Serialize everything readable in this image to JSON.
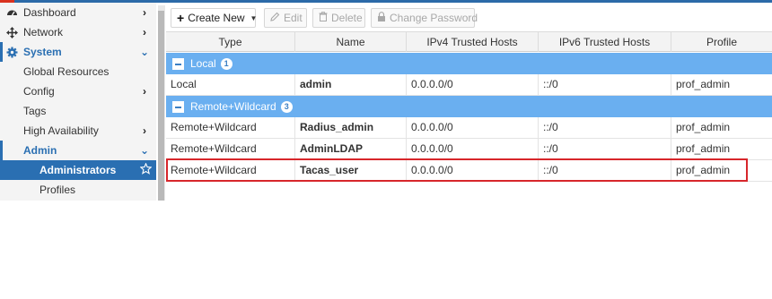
{
  "sidebar": {
    "items": [
      {
        "label": "Dashboard",
        "icon": "dashboard-icon",
        "chevron": "›"
      },
      {
        "label": "Network",
        "icon": "network-icon",
        "chevron": "›"
      },
      {
        "label": "System",
        "icon": "gear-icon",
        "chevron": "⌄"
      },
      {
        "label": "Global Resources"
      },
      {
        "label": "Config",
        "chevron": "›"
      },
      {
        "label": "Tags"
      },
      {
        "label": "High Availability",
        "chevron": "›"
      },
      {
        "label": "Admin",
        "chevron": "⌄"
      },
      {
        "label": "Administrators",
        "icon": "star-icon"
      },
      {
        "label": "Profiles"
      }
    ]
  },
  "toolbar": {
    "create_new": "Create New",
    "edit": "Edit",
    "delete": "Delete",
    "change_password": "Change Password"
  },
  "table": {
    "columns": [
      "Type",
      "Name",
      "IPv4 Trusted Hosts",
      "IPv6 Trusted Hosts",
      "Profile"
    ],
    "groups": [
      {
        "label": "Local",
        "count": "1",
        "rows": [
          {
            "type": "Local",
            "name": "admin",
            "ipv4": "0.0.0.0/0",
            "ipv6": "::/0",
            "profile": "prof_admin"
          }
        ]
      },
      {
        "label": "Remote+Wildcard",
        "count": "3",
        "rows": [
          {
            "type": "Remote+Wildcard",
            "name": "Radius_admin",
            "ipv4": "0.0.0.0/0",
            "ipv6": "::/0",
            "profile": "prof_admin"
          },
          {
            "type": "Remote+Wildcard",
            "name": "AdminLDAP",
            "ipv4": "0.0.0.0/0",
            "ipv6": "::/0",
            "profile": "prof_admin"
          },
          {
            "type": "Remote+Wildcard",
            "name": "Tacas_user",
            "ipv4": "0.0.0.0/0",
            "ipv6": "::/0",
            "profile": "prof_admin"
          }
        ]
      }
    ]
  },
  "colors": {
    "accent": "#2a6fb2",
    "group_header": "#6aaff0",
    "highlight": "#d7262b"
  }
}
